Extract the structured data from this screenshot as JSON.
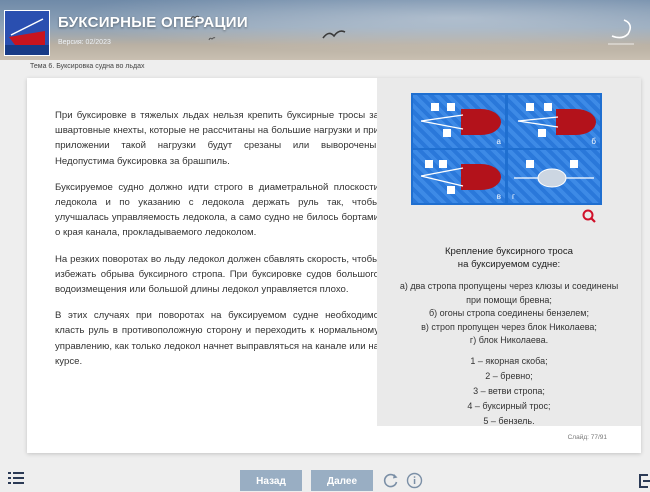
{
  "header": {
    "title": "БУКСИРНЫЕ ОПЕРАЦИИ",
    "version": "Версия: 02/2023",
    "brand_icon": "ship-logo",
    "brand_mark_icon": "brand-swirl-logo"
  },
  "topic": "Тема 6. Буксировка судна во льдах",
  "body": {
    "paragraphs": [
      "При буксировке в тяжелых льдах нельзя крепить буксирные тросы за швартовные кнехты, которые не рассчитаны на большие нагрузки и при приложении такой нагрузки будут срезаны или выворочены. Недопустима буксировка за брашпиль.",
      "Буксируемое судно должно идти строго в диаметральной плоскости ледокола и по указанию с ледокола держать руль так, чтобы улучшалась управляемость ледокола, а само судно не билось бортами о края канала, прокладываемого ледоколом.",
      "На резких поворотах во льду ледокол должен сбавлять скорость, чтобы избежать обрыва буксирного стропа. При буксировке судов большого водоизмещения или большой длины ледокол управляется плохо.",
      "В этих случаях при поворотах на буксируемом судне необходимо класть руль в противоположную сторону и переходить к нормальному управлению, как только ледокол начнет выправляться на канале или на курсе."
    ]
  },
  "figure": {
    "panel_labels": [
      "а",
      "б",
      "в",
      "г"
    ],
    "caption_title_1": "Крепление буксирного троса",
    "caption_title_2": "на буксируемом судне:",
    "caption_lines": [
      "а) два стропа пропущены через клюзы и соединены",
      "при помощи бревна;",
      "б) огоны стропа соединены бензелем;",
      "в) строп пропущен через блок Николаева;",
      "г) блок Николаева."
    ],
    "legend": [
      "1 – якорная скоба;",
      "2 – бревно;",
      "3 – ветви стропа;",
      "4 – буксирный трос;",
      "5 – бензель."
    ],
    "colors": {
      "water": "#1f6fd0",
      "hull": "#b3121b"
    }
  },
  "slide_counter": "Слайд: 77/91",
  "footer": {
    "prev_label": "Назад",
    "next_label": "Далее",
    "button_color": "#99aec3"
  }
}
